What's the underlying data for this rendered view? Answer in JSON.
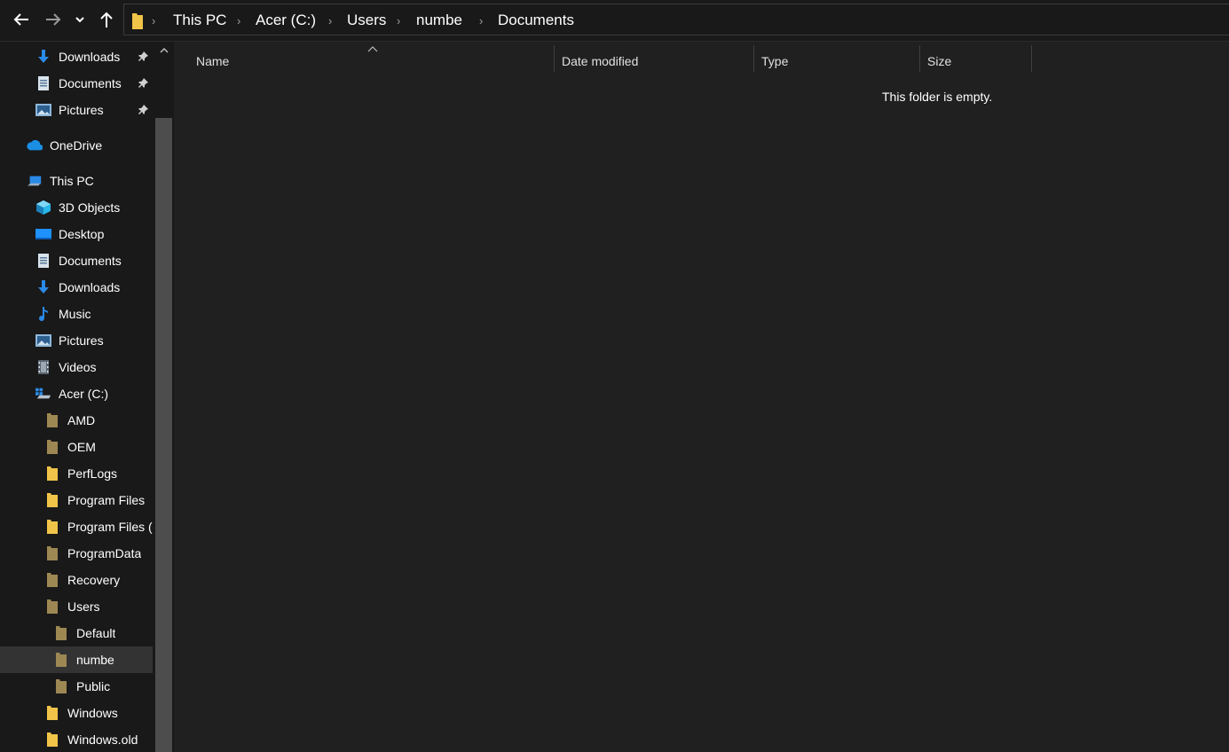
{
  "address": {
    "crumbs": [
      "This PC",
      "Acer (C:)",
      "Users",
      "numbe",
      "Documents"
    ]
  },
  "nav": {
    "back_icon": "back-arrow-icon",
    "forward_icon": "forward-arrow-icon",
    "recent_icon": "chevron-down-icon",
    "up_icon": "up-arrow-icon"
  },
  "sidebar": {
    "quick_access": [
      {
        "label": "Downloads",
        "icon": "download-icon",
        "pinned": true
      },
      {
        "label": "Documents",
        "icon": "document-icon",
        "pinned": true
      },
      {
        "label": "Pictures",
        "icon": "pictures-icon",
        "pinned": true
      }
    ],
    "onedrive": {
      "label": "OneDrive",
      "icon": "cloud-icon"
    },
    "this_pc": {
      "label": "This PC",
      "icon": "computer-icon"
    },
    "pc_items": [
      {
        "label": "3D Objects",
        "icon": "cube-icon"
      },
      {
        "label": "Desktop",
        "icon": "desktop-icon"
      },
      {
        "label": "Documents",
        "icon": "document-icon"
      },
      {
        "label": "Downloads",
        "icon": "download-icon"
      },
      {
        "label": "Music",
        "icon": "music-icon"
      },
      {
        "label": "Pictures",
        "icon": "pictures-icon"
      },
      {
        "label": "Videos",
        "icon": "video-icon"
      },
      {
        "label": "Acer (C:)",
        "icon": "drive-icon"
      }
    ],
    "drive_folders": [
      {
        "label": "AMD",
        "dim": true
      },
      {
        "label": "OEM",
        "dim": true
      },
      {
        "label": "PerfLogs",
        "dim": false
      },
      {
        "label": "Program Files",
        "dim": false
      },
      {
        "label": "Program Files (",
        "dim": false
      },
      {
        "label": "ProgramData",
        "dim": true
      },
      {
        "label": "Recovery",
        "dim": true
      },
      {
        "label": "Users",
        "dim": true
      }
    ],
    "user_folders": [
      {
        "label": "Default",
        "dim": true
      },
      {
        "label": "numbe",
        "dim": true,
        "selected": true
      },
      {
        "label": "Public",
        "dim": true
      }
    ],
    "tail_folders": [
      {
        "label": "Windows",
        "dim": false
      },
      {
        "label": "Windows.old",
        "dim": false
      }
    ]
  },
  "columns": {
    "name": "Name",
    "date_modified": "Date modified",
    "type": "Type",
    "size": "Size"
  },
  "content": {
    "empty_message": "This folder is empty."
  },
  "colors": {
    "background": "#191919",
    "content_bg": "#202020",
    "folder_yellow": "#f0c449",
    "folder_dim": "#9d8753",
    "accent_blue": "#2a8ae6"
  }
}
